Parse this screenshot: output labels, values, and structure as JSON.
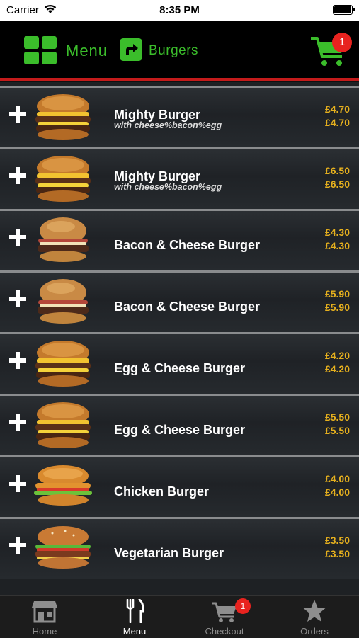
{
  "status": {
    "carrier": "Carrier",
    "time": "8:35 PM"
  },
  "header": {
    "menu_label": "Menu",
    "crumb_label": "Burgers",
    "cart_count": "1"
  },
  "items": [
    {
      "name": "Mighty Burger",
      "subtitle": "with cheese%bacon%egg",
      "price1": "£4.70",
      "price2": "£4.70",
      "image": "stacked-burger"
    },
    {
      "name": "Mighty Burger",
      "subtitle": "with cheese%bacon%egg",
      "price1": "£6.50",
      "price2": "£6.50",
      "image": "stacked-burger"
    },
    {
      "name": "Bacon & Cheese Burger",
      "subtitle": "",
      "price1": "£4.30",
      "price2": "£4.30",
      "image": "bacon-burger"
    },
    {
      "name": "Bacon & Cheese Burger",
      "subtitle": "",
      "price1": "£5.90",
      "price2": "£5.90",
      "image": "bacon-burger"
    },
    {
      "name": "Egg & Cheese Burger",
      "subtitle": "",
      "price1": "£4.20",
      "price2": "£4.20",
      "image": "stacked-burger"
    },
    {
      "name": "Egg & Cheese Burger",
      "subtitle": "",
      "price1": "£5.50",
      "price2": "£5.50",
      "image": "stacked-burger"
    },
    {
      "name": "Chicken Burger",
      "subtitle": "",
      "price1": "£4.00",
      "price2": "£4.00",
      "image": "chicken-burger"
    },
    {
      "name": "Vegetarian Burger",
      "subtitle": "",
      "price1": "£3.50",
      "price2": "£3.50",
      "image": "veggie-burger"
    }
  ],
  "tabs": [
    {
      "label": "Home",
      "icon": "store-icon"
    },
    {
      "label": "Menu",
      "icon": "fork-knife-icon",
      "active": true
    },
    {
      "label": "Checkout",
      "icon": "cart-icon",
      "badge": "1"
    },
    {
      "label": "Orders",
      "icon": "star-icon"
    }
  ],
  "colors": {
    "accent_green": "#3bbd2b",
    "price_gold": "#e6b01e",
    "badge_red": "#e8231f",
    "header_rule": "#c41b1b"
  }
}
